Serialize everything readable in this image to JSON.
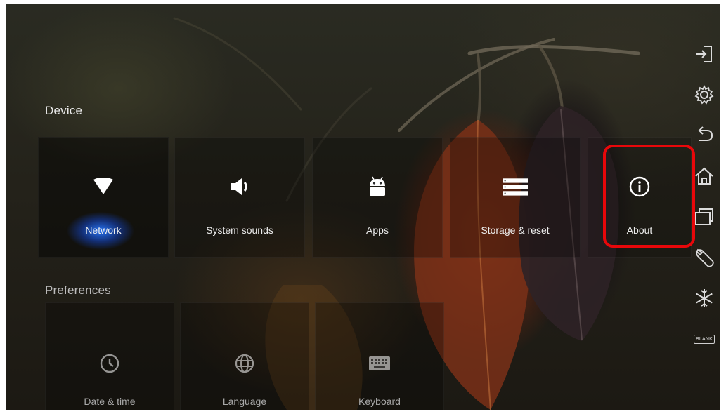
{
  "sections": {
    "device_title": "Device",
    "preferences_title": "Preferences"
  },
  "device_tiles": [
    {
      "label": "Network",
      "icon": "wifi-icon",
      "focused": true
    },
    {
      "label": "System sounds",
      "icon": "speaker-icon"
    },
    {
      "label": "Apps",
      "icon": "android-icon"
    },
    {
      "label": "Storage & reset",
      "icon": "storage-icon"
    },
    {
      "label": "About",
      "icon": "info-icon",
      "highlighted": true
    }
  ],
  "preference_tiles": [
    {
      "label": "Date & time",
      "icon": "clock-icon"
    },
    {
      "label": "Language",
      "icon": "globe-icon"
    },
    {
      "label": "Keyboard",
      "icon": "keyboard-icon"
    }
  ],
  "side_rail": [
    {
      "icon": "input-source-icon"
    },
    {
      "icon": "settings-gear-icon"
    },
    {
      "icon": "back-icon"
    },
    {
      "icon": "home-icon"
    },
    {
      "icon": "multitask-icon"
    },
    {
      "icon": "wrench-icon"
    },
    {
      "icon": "freeze-icon"
    },
    {
      "icon": "blank-screen-icon",
      "text": "BLANK"
    }
  ],
  "colors": {
    "highlight": "#e8070a",
    "focus_glow": "#2878ff"
  }
}
